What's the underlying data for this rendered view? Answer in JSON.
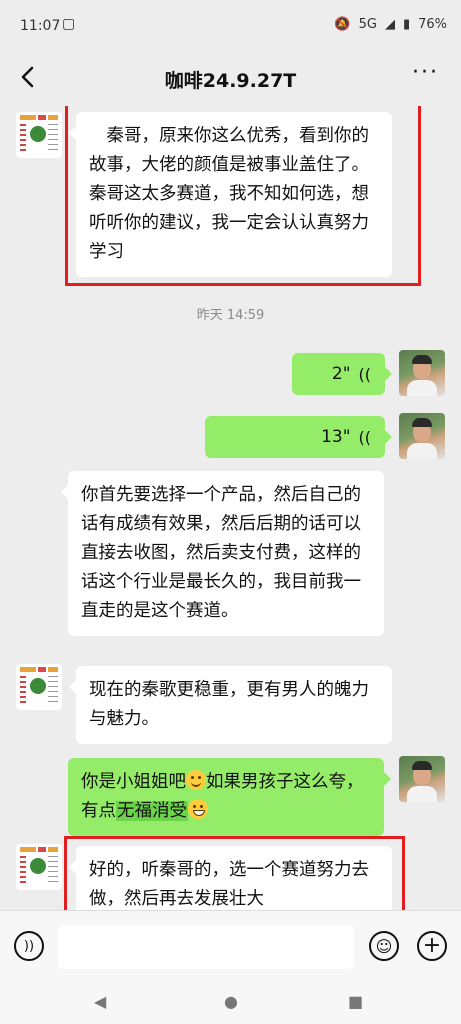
{
  "status": {
    "time": "11:07",
    "network": "5G",
    "battery": "76%"
  },
  "header": {
    "title": "咖啡24.9.27T",
    "more": "···"
  },
  "messages": {
    "m1": "　秦哥，原来你这么优秀，看到你的故事，大佬的颜值是被事业盖住了。秦哥这太多赛道，我不知如何选，想听听你的建议，我一定会认认真努力学习",
    "timestamp": "昨天 14:59",
    "voice1": "2\"",
    "voice2": "13\"",
    "m2": "你首先要选择一个产品，然后自己的话有成绩有效果，然后后期的话可以直接去收图，然后卖支付费，这样的话这个行业是最长久的，我目前我一直走的是这个赛道。",
    "m3": "现在的秦歌更稳重，更有男人的魄力与魅力。",
    "m4_part1": "你是小姐姐吧",
    "m4_part2": "如果男孩子这么夸，有点",
    "m4_highlight": "无福消受",
    "m5": "好的，听秦哥的，选一个赛道努力去做，然后再去发展壮大"
  },
  "icons": {
    "voice": "voice-input-icon",
    "emoji": "emoji-icon",
    "plus": "plus-icon",
    "back": "back-arrow-icon"
  },
  "colors": {
    "sent_bubble": "#95ec69",
    "received_bubble": "#ffffff",
    "highlight_box": "#e02020"
  }
}
